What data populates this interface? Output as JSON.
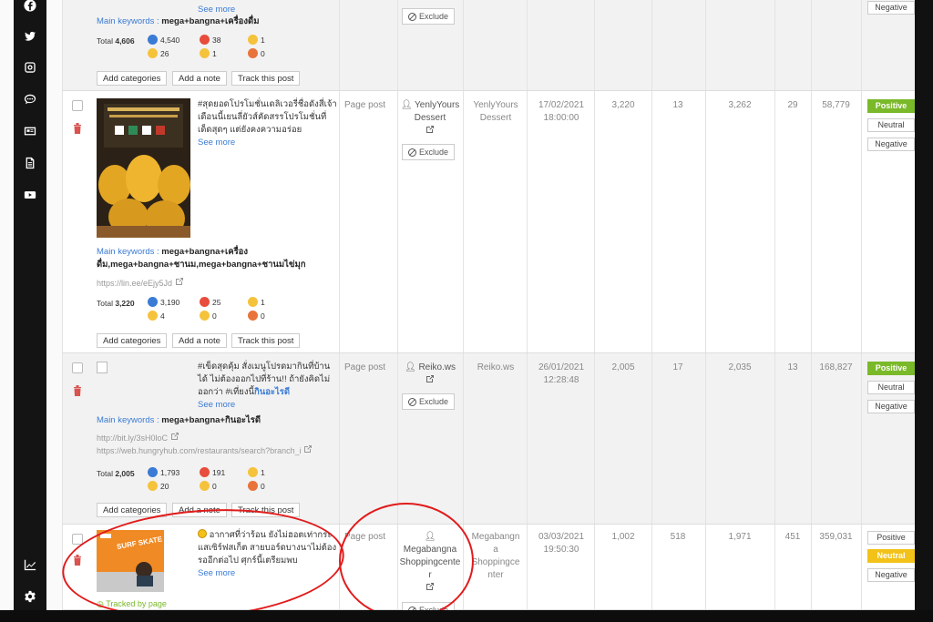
{
  "sidebar": {
    "icons": [
      "facebook-icon",
      "twitter-icon",
      "instagram-icon",
      "chat-icon",
      "news-icon",
      "document-icon",
      "youtube-icon"
    ],
    "bottom_icons": [
      "analytics-icon",
      "settings-icon"
    ]
  },
  "colors": {
    "positive": "#7ab929",
    "neutral_active": "#f2c218",
    "link": "#3a7bd5",
    "delete": "#d9534f",
    "annotation": "#e11b1b"
  },
  "labels": {
    "see_more": "See more",
    "add_categories": "Add categories",
    "add_note": "Add a note",
    "track_post": "Track this post",
    "exclude": "Exclude",
    "page_post": "Page post",
    "positive": "Positive",
    "neutral": "Neutral",
    "negative": "Negative",
    "main_keywords": "Main keywords :",
    "total": "Total"
  },
  "rows": [
    {
      "see_more": "See more",
      "keywords": "mega+bangna+เครื่องดื่ม",
      "total": "4,606",
      "reactions": {
        "like": "4,540",
        "love": "38",
        "haha": "1",
        "wow": "26",
        "sad": "1",
        "angry": "0"
      }
    },
    {
      "text": "#สุดยอดโปรโมชั่นเดลิเวอรี่ชื่อดังสี่เจ้า เดือนนี้เยนลี่ยัวส์คัดสรรโปรโมชั่นที่เด็ดสุดๆ แต่ยังคงความอร่อย",
      "keywords": "mega+bangna+เครื่องดื่ม,mega+bangna+ชานม,mega+bangna+ชานมไข่มุก",
      "links": [
        "https://lin.ee/eEjy5Jd"
      ],
      "total": "3,220",
      "reactions": {
        "like": "3,190",
        "love": "25",
        "haha": "1",
        "wow": "4",
        "sad": "0",
        "angry": "0"
      },
      "type": "Page post",
      "author": "YenlyYours Dessert",
      "source": "YenlyYours Dessert",
      "date": "17/02/2021",
      "time": "18:00:00",
      "c1": "3,220",
      "c2": "13",
      "c3": "3,262",
      "c4": "29",
      "c5": "58,779"
    },
    {
      "text": "#เข็ดสุดคุ้ม สั่งเมนูโปรดมากินที่บ้านได้ ไม่ต้องออกไปที่ร้าน!! ถ้ายังคิดไม่ออกว่า #เที่ยงนี้",
      "text_bold": "กินอะไรดี",
      "keywords": "mega+bangna+กินอะไรดี",
      "links": [
        "http://bit.ly/3sH0loC",
        "https://web.hungryhub.com/restaurants/search?branch_i"
      ],
      "total": "2,005",
      "reactions": {
        "like": "1,793",
        "love": "191",
        "haha": "1",
        "wow": "20",
        "sad": "0",
        "angry": "0"
      },
      "type": "Page post",
      "author": "Reiko.ws",
      "source": "Reiko.ws",
      "date": "26/01/2021",
      "time": "12:28:48",
      "c1": "2,005",
      "c2": "17",
      "c3": "2,035",
      "c4": "13",
      "c5": "168,827"
    },
    {
      "text": "อากาศที่ว่าร้อน ยังไม่ฮอตเท่ากระแสเซิร์ฟสเก็ต สายบอร์ดบางนาไม่ต้องรออีกต่อไป ศุกร์นี้เตรียมพบ",
      "tracked": "Tracked by page",
      "thumb_text": "SURF SKATE PLAY AREA",
      "type": "Page post",
      "author_lines": [
        "Megabangna",
        "Shoppingcente",
        "r"
      ],
      "source_lines": [
        "Megabangn",
        "a",
        "Shoppingce",
        "nter"
      ],
      "date": "03/03/2021",
      "time": "19:50:30",
      "c1": "1,002",
      "c2": "518",
      "c3": "1,971",
      "c4": "451",
      "c5": "359,031"
    }
  ]
}
